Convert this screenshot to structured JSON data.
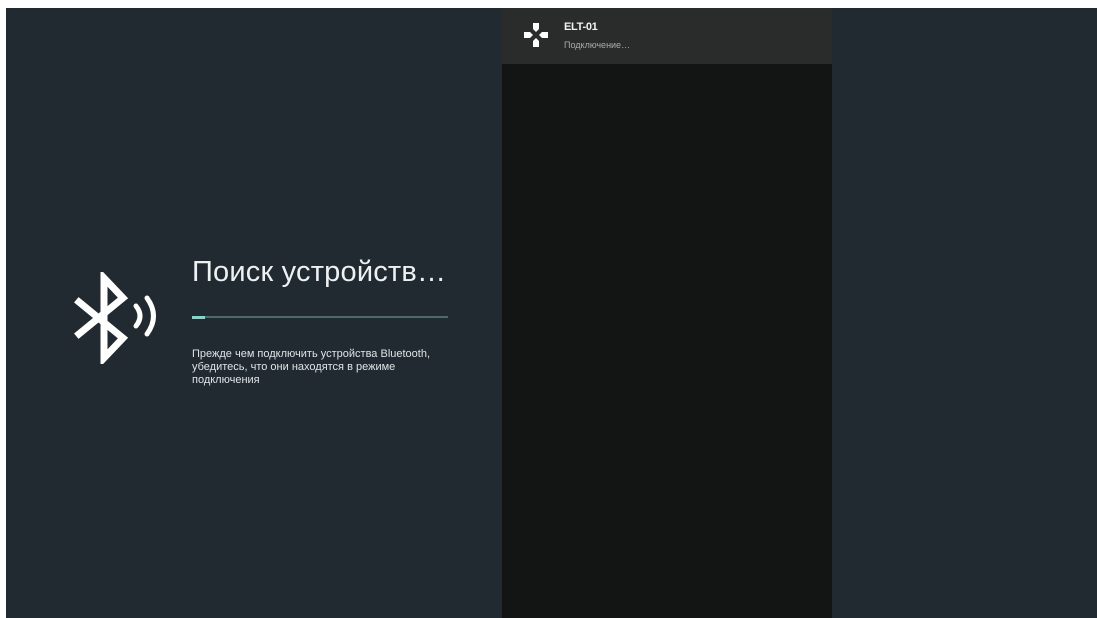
{
  "screen": {
    "background": "#212a30",
    "accent": "#7fd7cb"
  },
  "search": {
    "title": "Поиск устройств…",
    "progress_fraction": 0.05,
    "hint": "Прежде чем подключить устройства Bluetooth, убедитесь, что они находятся в режиме подключения",
    "icon": "bluetooth-searching-icon"
  },
  "devices": [
    {
      "name": "ELT-01",
      "status": "Подключение…",
      "icon": "gamepad-icon"
    }
  ]
}
